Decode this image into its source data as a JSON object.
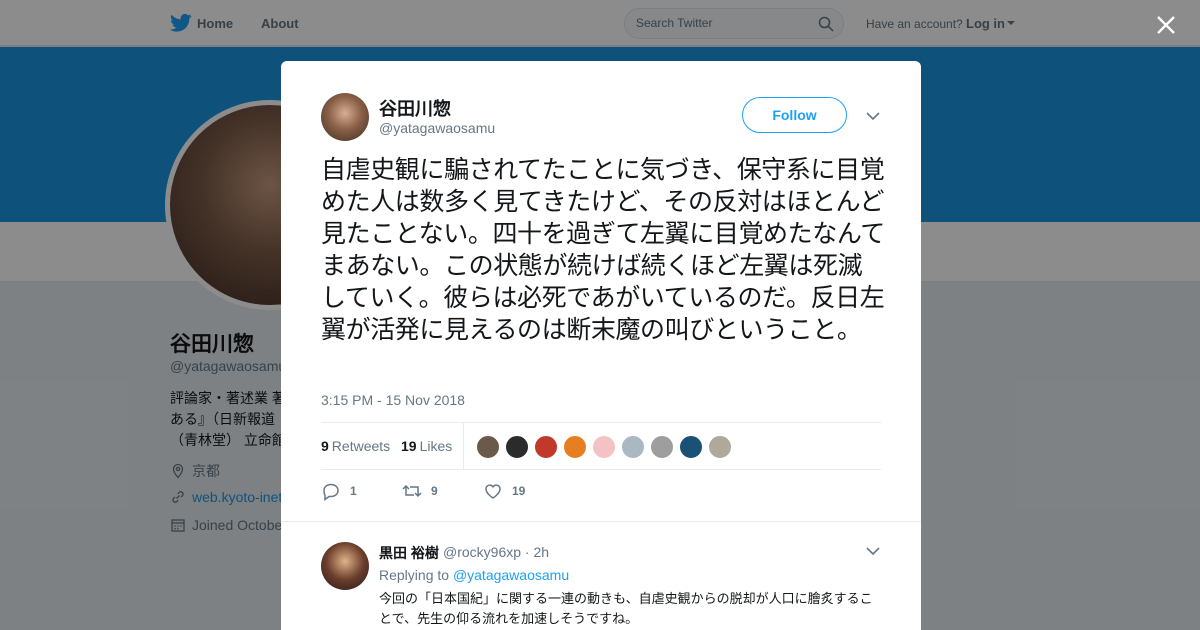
{
  "nav": {
    "home_label": "Home",
    "about_label": "About",
    "search_placeholder": "Search Twitter",
    "have_account": "Have an account?",
    "login_label": "Log in"
  },
  "profile": {
    "name": "谷田川惣",
    "handle": "@yatagawaosamu",
    "bio_lines": [
      "評論家・著述業 著",
      "ある』（日新報道",
      "（青林堂） 立命館"
    ],
    "location": "京都",
    "website": "web.kyoto-inet",
    "joined": "Joined October"
  },
  "tweet": {
    "author_name": "谷田川惣",
    "author_handle": "@yatagawaosamu",
    "follow_label": "Follow",
    "text": "自虐史観に騙されてたことに気づき、保守系に目覚めた人は数多く見てきたけど、その反対はほとんど見たことない。四十を過ぎて左翼に目覚めたなんてまあない。この状態が続けば続くほど左翼は死滅していく。彼らは必死であがいているのだ。反日左翼が活発に見えるのは断末魔の叫びということ。",
    "timestamp": "3:15 PM - 15 Nov 2018",
    "retweets_count": "9",
    "retweets_label": "Retweets",
    "likes_count": "19",
    "likes_label": "Likes",
    "liker_colors": [
      "#6b5a4a",
      "#2b2b2b",
      "#c0392b",
      "#e67e22",
      "#f4c2c2",
      "#aab8c2",
      "#9e9e9e",
      "#1a5276",
      "#b0a89a"
    ],
    "reply_count": "1",
    "retweet_action_count": "9",
    "like_action_count": "19"
  },
  "reply": {
    "name": "黒田 裕樹",
    "handle_time": "@rocky96xp · 2h",
    "replying_prefix": "Replying to",
    "replying_mention": "@yatagawaosamu",
    "text": "今回の「日本国紀」に関する一連の動きも、自虐史観からの脱却が人口に膾炙することで、先生の仰る流れを加速しそうですね。"
  }
}
